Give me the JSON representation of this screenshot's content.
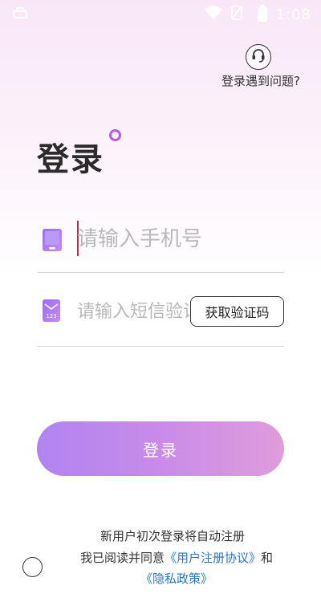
{
  "status_bar": {
    "time": "1:08",
    "icons": [
      "notification-icon",
      "wifi-icon",
      "no-sim-icon",
      "battery-icon"
    ]
  },
  "help": {
    "icon": "headset-icon",
    "label": "登录遇到问题?"
  },
  "title": "登录",
  "phone_field": {
    "icon": "phone-icon",
    "placeholder": "请输入手机号"
  },
  "code_field": {
    "icon": "sms-code-icon",
    "icon_text": "123",
    "placeholder": "请输入短信验证码",
    "button_label": "获取验证码"
  },
  "login_button": "登录",
  "footer": {
    "notice": "新用户初次登录将自动注册",
    "agree_prefix": "我已阅读并同意",
    "user_agreement": "《用户注册协议》",
    "and": "和",
    "privacy_policy": "《隐私政策》"
  },
  "colors": {
    "accent": "#b35fe6",
    "link": "#2a76d2",
    "button_gradient_start": "#b084f0",
    "button_gradient_end": "#e09cdb",
    "caret": "#c62b3d"
  }
}
